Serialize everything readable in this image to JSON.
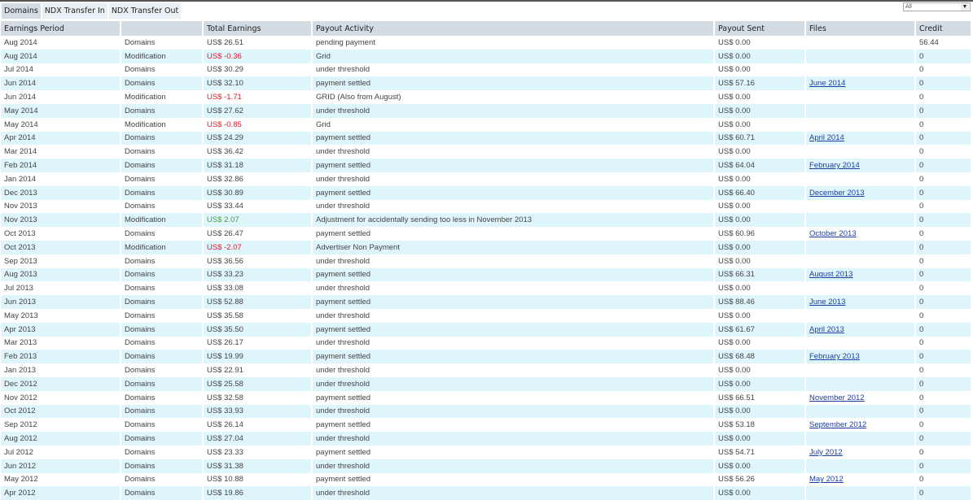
{
  "tabs": [
    "Domains",
    "NDX Transfer In",
    "NDX Transfer Out"
  ],
  "filter": {
    "value": "All"
  },
  "headers": [
    "Earnings Period",
    "",
    "Total Earnings",
    "Payout Activity",
    "Payout Sent",
    "Files",
    "Credit"
  ],
  "colors": {
    "negative": "#e0182d",
    "positive": "#4a9e3a",
    "link": "#1a3fa0"
  },
  "rows": [
    {
      "period": "Aug 2014",
      "type": "Domains",
      "earnings": "US$ 26.51",
      "sign": "",
      "activity": "pending payment",
      "sent": "US$ 0.00",
      "file": "",
      "credit": "56.44"
    },
    {
      "period": "Aug 2014",
      "type": "Modification",
      "earnings": "US$ -0.36",
      "sign": "neg",
      "activity": "Grid",
      "sent": "US$ 0.00",
      "file": "",
      "credit": "0"
    },
    {
      "period": "Jul 2014",
      "type": "Domains",
      "earnings": "US$ 30.29",
      "sign": "",
      "activity": "under threshold",
      "sent": "US$ 0.00",
      "file": "",
      "credit": "0"
    },
    {
      "period": "Jun 2014",
      "type": "Domains",
      "earnings": "US$ 32.10",
      "sign": "",
      "activity": "payment settled",
      "sent": "US$ 57.16",
      "file": "June 2014",
      "credit": "0"
    },
    {
      "period": "Jun 2014",
      "type": "Modification",
      "earnings": "US$ -1.71",
      "sign": "neg",
      "activity": "GRID (Also from August)",
      "sent": "US$ 0.00",
      "file": "",
      "credit": "0"
    },
    {
      "period": "May 2014",
      "type": "Domains",
      "earnings": "US$ 27.62",
      "sign": "",
      "activity": "under threshold",
      "sent": "US$ 0.00",
      "file": "",
      "credit": "0"
    },
    {
      "period": "May 2014",
      "type": "Modification",
      "earnings": "US$ -0.85",
      "sign": "neg",
      "activity": "Grid",
      "sent": "US$ 0.00",
      "file": "",
      "credit": "0"
    },
    {
      "period": "Apr 2014",
      "type": "Domains",
      "earnings": "US$ 24.29",
      "sign": "",
      "activity": "payment settled",
      "sent": "US$ 60.71",
      "file": "April 2014",
      "credit": "0"
    },
    {
      "period": "Mar 2014",
      "type": "Domains",
      "earnings": "US$ 36.42",
      "sign": "",
      "activity": "under threshold",
      "sent": "US$ 0.00",
      "file": "",
      "credit": "0"
    },
    {
      "period": "Feb 2014",
      "type": "Domains",
      "earnings": "US$ 31.18",
      "sign": "",
      "activity": "payment settled",
      "sent": "US$ 64.04",
      "file": "February 2014",
      "credit": "0"
    },
    {
      "period": "Jan 2014",
      "type": "Domains",
      "earnings": "US$ 32.86",
      "sign": "",
      "activity": "under threshold",
      "sent": "US$ 0.00",
      "file": "",
      "credit": "0"
    },
    {
      "period": "Dec 2013",
      "type": "Domains",
      "earnings": "US$ 30.89",
      "sign": "",
      "activity": "payment settled",
      "sent": "US$ 66.40",
      "file": "December 2013",
      "credit": "0"
    },
    {
      "period": "Nov 2013",
      "type": "Domains",
      "earnings": "US$ 33.44",
      "sign": "",
      "activity": "under threshold",
      "sent": "US$ 0.00",
      "file": "",
      "credit": "0"
    },
    {
      "period": "Nov 2013",
      "type": "Modification",
      "earnings": "US$ 2.07",
      "sign": "pos",
      "activity": "Adjustment for accidentally sending too less in November 2013",
      "sent": "US$ 0.00",
      "file": "",
      "credit": "0"
    },
    {
      "period": "Oct 2013",
      "type": "Domains",
      "earnings": "US$ 26.47",
      "sign": "",
      "activity": "payment settled",
      "sent": "US$ 60.96",
      "file": "October 2013",
      "credit": "0"
    },
    {
      "period": "Oct 2013",
      "type": "Modification",
      "earnings": "US$ -2.07",
      "sign": "neg",
      "activity": "Advertiser Non Payment",
      "sent": "US$ 0.00",
      "file": "",
      "credit": "0"
    },
    {
      "period": "Sep 2013",
      "type": "Domains",
      "earnings": "US$ 36.56",
      "sign": "",
      "activity": "under threshold",
      "sent": "US$ 0.00",
      "file": "",
      "credit": "0"
    },
    {
      "period": "Aug 2013",
      "type": "Domains",
      "earnings": "US$ 33.23",
      "sign": "",
      "activity": "payment settled",
      "sent": "US$ 66.31",
      "file": "August 2013",
      "credit": "0"
    },
    {
      "period": "Jul 2013",
      "type": "Domains",
      "earnings": "US$ 33.08",
      "sign": "",
      "activity": "under threshold",
      "sent": "US$ 0.00",
      "file": "",
      "credit": "0"
    },
    {
      "period": "Jun 2013",
      "type": "Domains",
      "earnings": "US$ 52.88",
      "sign": "",
      "activity": "payment settled",
      "sent": "US$ 88.46",
      "file": "June 2013",
      "credit": "0"
    },
    {
      "period": "May 2013",
      "type": "Domains",
      "earnings": "US$ 35.58",
      "sign": "",
      "activity": "under threshold",
      "sent": "US$ 0.00",
      "file": "",
      "credit": "0"
    },
    {
      "period": "Apr 2013",
      "type": "Domains",
      "earnings": "US$ 35.50",
      "sign": "",
      "activity": "payment settled",
      "sent": "US$ 61.67",
      "file": "April 2013",
      "credit": "0"
    },
    {
      "period": "Mar 2013",
      "type": "Domains",
      "earnings": "US$ 26.17",
      "sign": "",
      "activity": "under threshold",
      "sent": "US$ 0.00",
      "file": "",
      "credit": "0"
    },
    {
      "period": "Feb 2013",
      "type": "Domains",
      "earnings": "US$ 19.99",
      "sign": "",
      "activity": "payment settled",
      "sent": "US$ 68.48",
      "file": "February 2013",
      "credit": "0"
    },
    {
      "period": "Jan 2013",
      "type": "Domains",
      "earnings": "US$ 22.91",
      "sign": "",
      "activity": "under threshold",
      "sent": "US$ 0.00",
      "file": "",
      "credit": "0"
    },
    {
      "period": "Dec 2012",
      "type": "Domains",
      "earnings": "US$ 25.58",
      "sign": "",
      "activity": "under threshold",
      "sent": "US$ 0.00",
      "file": "",
      "credit": "0"
    },
    {
      "period": "Nov 2012",
      "type": "Domains",
      "earnings": "US$ 32.58",
      "sign": "",
      "activity": "payment settled",
      "sent": "US$ 66.51",
      "file": "November 2012",
      "credit": "0"
    },
    {
      "period": "Oct 2012",
      "type": "Domains",
      "earnings": "US$ 33.93",
      "sign": "",
      "activity": "under threshold",
      "sent": "US$ 0.00",
      "file": "",
      "credit": "0"
    },
    {
      "period": "Sep 2012",
      "type": "Domains",
      "earnings": "US$ 26.14",
      "sign": "",
      "activity": "payment settled",
      "sent": "US$ 53.18",
      "file": "September 2012",
      "credit": "0"
    },
    {
      "period": "Aug 2012",
      "type": "Domains",
      "earnings": "US$ 27.04",
      "sign": "",
      "activity": "under threshold",
      "sent": "US$ 0.00",
      "file": "",
      "credit": "0"
    },
    {
      "period": "Jul 2012",
      "type": "Domains",
      "earnings": "US$ 23.33",
      "sign": "",
      "activity": "payment settled",
      "sent": "US$ 54.71",
      "file": "July 2012",
      "credit": "0"
    },
    {
      "period": "Jun 2012",
      "type": "Domains",
      "earnings": "US$ 31.38",
      "sign": "",
      "activity": "under threshold",
      "sent": "US$ 0.00",
      "file": "",
      "credit": "0"
    },
    {
      "period": "May 2012",
      "type": "Domains",
      "earnings": "US$ 10.88",
      "sign": "",
      "activity": "payment settled",
      "sent": "US$ 56.26",
      "file": "May 2012",
      "credit": "0"
    },
    {
      "period": "Apr 2012",
      "type": "Domains",
      "earnings": "US$ 19.86",
      "sign": "",
      "activity": "under threshold",
      "sent": "US$ 0.00",
      "file": "",
      "credit": "0"
    }
  ]
}
